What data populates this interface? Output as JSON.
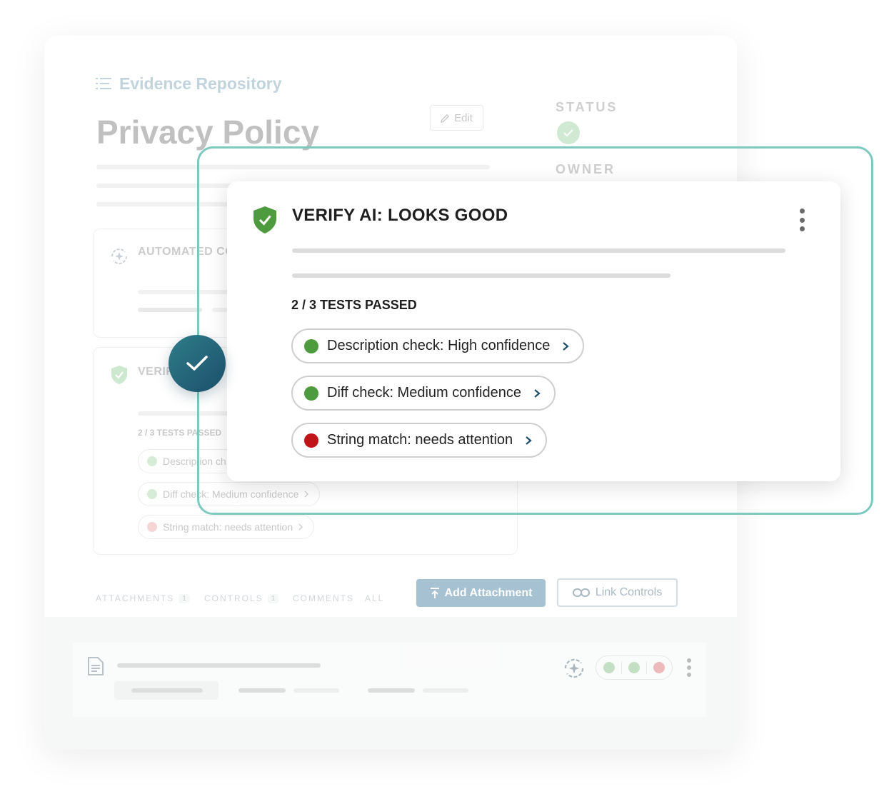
{
  "breadcrumb": {
    "label": "Evidence Repository"
  },
  "document": {
    "title": "Privacy Policy",
    "edit_label": "Edit"
  },
  "meta": {
    "status_label": "STATUS",
    "owner_label": "OWNER"
  },
  "background_cards": {
    "automated": {
      "title": "AUTOMATED CO"
    },
    "verify": {
      "title": "VERIF",
      "tests_count": "2 / 3 TESTS PASSED",
      "tests": [
        {
          "label": "Description ch",
          "status": "pass"
        },
        {
          "label": "Diff check: Medium confidence",
          "status": "pass"
        },
        {
          "label": "String match: needs attention",
          "status": "fail"
        }
      ]
    }
  },
  "tabs": [
    {
      "label": "ATTACHMENTS",
      "badge": "1"
    },
    {
      "label": "CONTROLS",
      "badge": "1"
    },
    {
      "label": "COMMENTS"
    },
    {
      "label": "ALL"
    }
  ],
  "actions": {
    "add_attachment": "Add Attachment",
    "link_controls": "Link Controls"
  },
  "popup": {
    "title": "VERIFY AI: LOOKS GOOD",
    "tests_count": "2 / 3 TESTS PASSED",
    "tests": [
      {
        "label": "Description check: High confidence",
        "status": "pass"
      },
      {
        "label": "Diff check: Medium confidence",
        "status": "pass"
      },
      {
        "label": "String match: needs attention",
        "status": "fail"
      }
    ]
  },
  "colors": {
    "pass": "#4e9a3e",
    "fail": "#c0141b",
    "pass_faded": "#b6dcb6",
    "fail_faded": "#efb3b3",
    "teal_outline": "#7ec9bf",
    "check_bubble": "#1b4f6b",
    "shield_green": "#4e9a3e"
  },
  "icons": {
    "breadcrumb": "list-icon",
    "edit": "pencil-icon",
    "shield": "shield-check-icon",
    "menu": "kebab-icon",
    "chevron": "chevron-right-icon",
    "check": "check-icon",
    "upload": "upload-icon",
    "link": "link-icon",
    "document": "document-icon",
    "automation": "sparkle-refresh-icon"
  }
}
